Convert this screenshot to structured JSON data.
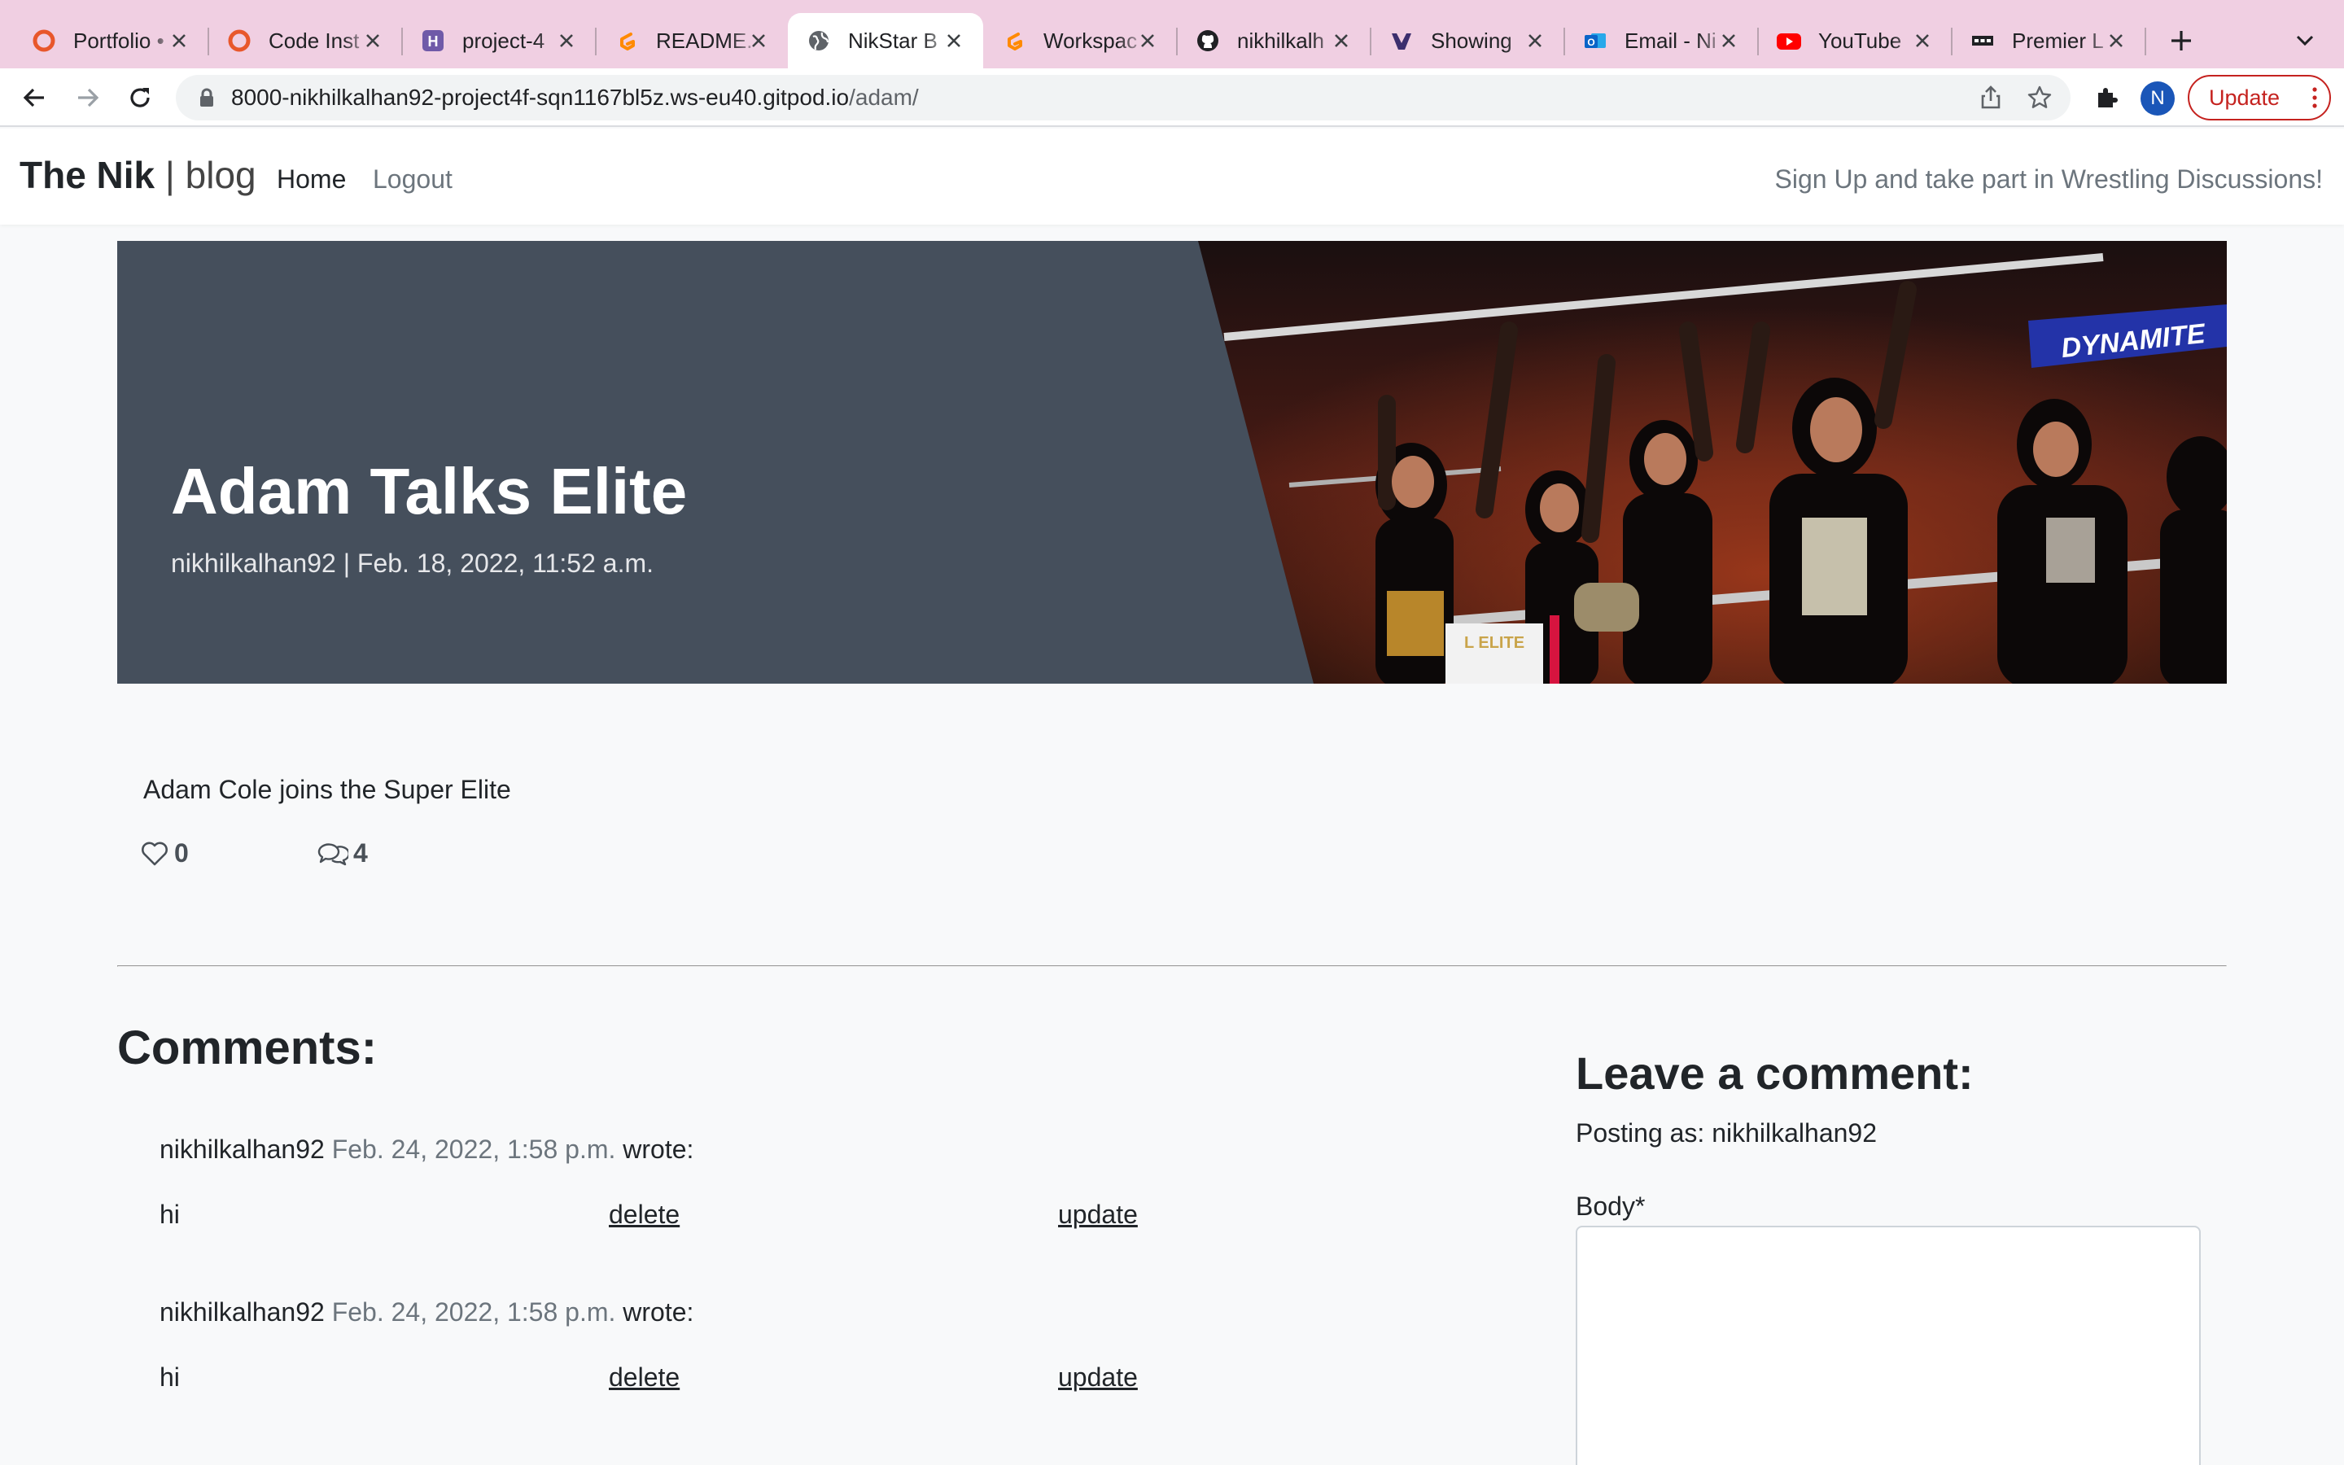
{
  "browser": {
    "tabs": [
      {
        "title": "Portfolio •",
        "icon": "portfolio-favicon",
        "color": "#e8572b"
      },
      {
        "title": "Code Inst",
        "icon": "code-institute-favicon",
        "color": "#e8572b"
      },
      {
        "title": "project-4",
        "icon": "heroku-favicon",
        "color": "#6f5aa8"
      },
      {
        "title": "README.",
        "icon": "gitpod-favicon",
        "color": "#ff8a00"
      },
      {
        "title": "NikStar B",
        "icon": "globe-icon",
        "color": "#5f6368"
      },
      {
        "title": "Workspac",
        "icon": "gitpod-favicon",
        "color": "#ff8a00"
      },
      {
        "title": "nikhilkalh",
        "icon": "github-favicon",
        "color": "#202124"
      },
      {
        "title": "Showing",
        "icon": "site-favicon",
        "color": "#3c2f6e"
      },
      {
        "title": "Email - Ni",
        "icon": "outlook-favicon",
        "color": "#0a64c8"
      },
      {
        "title": "YouTube",
        "icon": "youtube-favicon",
        "color": "#ff0000"
      },
      {
        "title": "Premier L",
        "icon": "premier-league-favicon",
        "color": "#202124"
      }
    ],
    "active_tab_index": 4,
    "url_host": "8000-nikhilkalhan92-project4f-sqn1167bl5z.ws-eu40.gitpod.io",
    "url_path": "/adam/",
    "profile_initial": "N",
    "update_label": "Update"
  },
  "site": {
    "brand_bold": "The Nik",
    "brand_sep": " | ",
    "brand_light": "blog",
    "nav": {
      "home": "Home",
      "logout": "Logout"
    },
    "signup_text": "Sign Up and take part in Wrestling Discussions!"
  },
  "post": {
    "title": "Adam Talks Elite",
    "meta": "nikhilkalhan92 | Feb. 18, 2022, 11:52 a.m.",
    "excerpt": "Adam Cole joins the Super Elite",
    "likes": "0",
    "comments": "4",
    "image_text_1": "DYNAMITE",
    "image_text_2": "L ELITE"
  },
  "comments_section": {
    "heading": "Comments:",
    "items": [
      {
        "author": "nikhilkalhan92",
        "date": "Feb. 24, 2022, 1:58 p.m.",
        "wrote": "wrote:",
        "body": "hi",
        "delete": "delete",
        "update": "update"
      },
      {
        "author": "nikhilkalhan92",
        "date": "Feb. 24, 2022, 1:58 p.m.",
        "wrote": "wrote:",
        "body": "hi",
        "delete": "delete",
        "update": "update"
      }
    ]
  },
  "leave_comment": {
    "heading": "Leave a comment:",
    "posting_as": "Posting as: nikhilkalhan92",
    "body_label": "Body*",
    "body_value": ""
  },
  "colors": {
    "tabstrip": "#f0cfe2",
    "masthead": "#454f5c",
    "page_bg": "#f8f9fa",
    "update_red": "#c5221f"
  }
}
